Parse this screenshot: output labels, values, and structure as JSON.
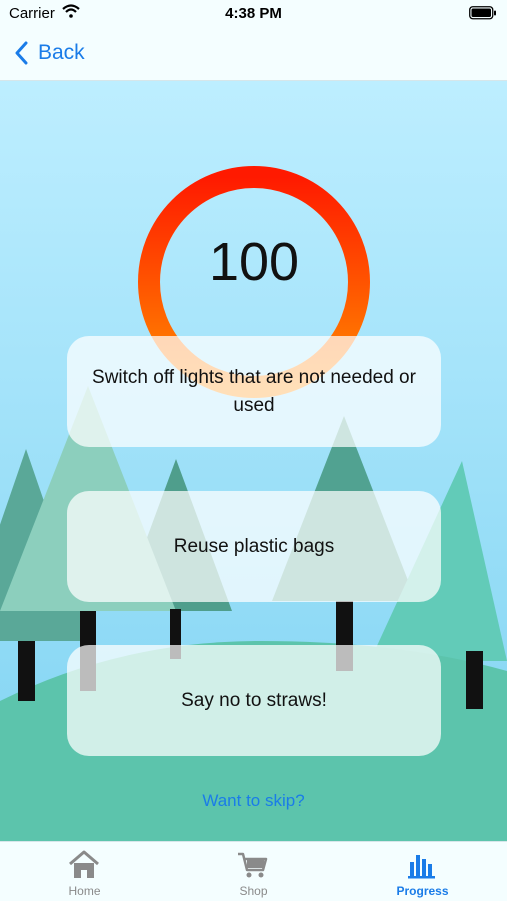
{
  "status_bar": {
    "carrier": "Carrier",
    "time": "4:38 PM"
  },
  "nav": {
    "back_label": "Back"
  },
  "score": {
    "value": "100",
    "progress": 1.0
  },
  "tips": [
    {
      "text": "Switch off lights that are not needed or used"
    },
    {
      "text": "Reuse plastic bags"
    },
    {
      "text": "Say no to straws!"
    }
  ],
  "skip_label": "Want to skip?",
  "tabs": [
    {
      "label": "Home",
      "icon": "home-icon",
      "active": false
    },
    {
      "label": "Shop",
      "icon": "cart-icon",
      "active": false
    },
    {
      "label": "Progress",
      "icon": "bar-chart-icon",
      "active": true
    }
  ],
  "colors": {
    "accent": "#1a7ce8",
    "ring_start": "#ff8c00",
    "ring_end": "#ff1a00",
    "sky_top": "#bdeeff",
    "sky_bottom": "#7fd3f2",
    "ground": "#5cc4ac"
  }
}
